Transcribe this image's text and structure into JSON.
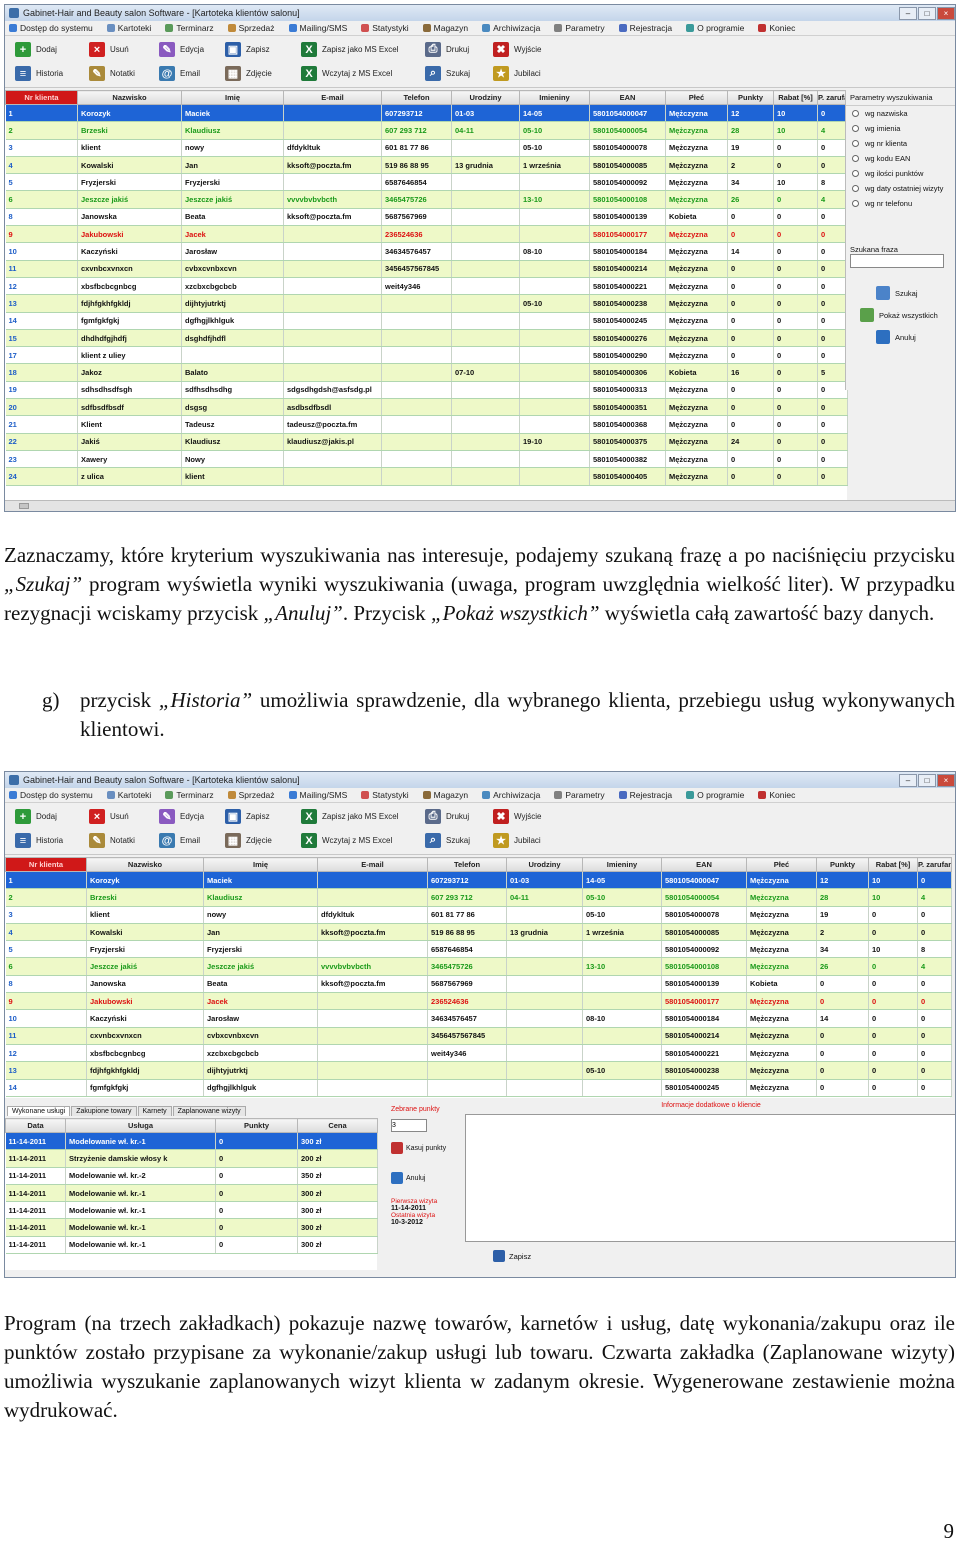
{
  "window": {
    "title": "Gabinet-Hair and Beauty salon Software - [Kartoteka klientów salonu]",
    "menu": [
      "Dostęp do systemu",
      "Kartoteki",
      "Terminarz",
      "Sprzedaż",
      "Mailing/SMS",
      "Statystyki",
      "Magazyn",
      "Archiwizacja",
      "Parametry",
      "Rejestracja",
      "O programie",
      "Koniec"
    ],
    "toolbar_row1": [
      "Dodaj",
      "Usuń",
      "Edycja",
      "Zapisz",
      "Zapisz jako MS Excel",
      "Drukuj",
      "Wyjście"
    ],
    "toolbar_row2": [
      "Historia",
      "Notatki",
      "Email",
      "Zdjęcie",
      "Wczytaj z MS Excel",
      "Szukaj",
      "Jubilaci"
    ],
    "columns": [
      "Nr klienta",
      "Nazwisko",
      "Imię",
      "E-mail",
      "Telefon",
      "Urodziny",
      "Imieniny",
      "EAN",
      "Płeć",
      "Punkty",
      "Rabat [%]",
      "P. zarufania"
    ]
  },
  "grid1": [
    [
      "1",
      "Korozyk",
      "Maciek",
      "",
      "607293712",
      "01-03",
      "14-05",
      "5801054000047",
      "Mężczyzna",
      "12",
      "10",
      "0"
    ],
    [
      "2",
      "Brzeski",
      "Klaudiusz",
      "",
      "607 293 712",
      "04-11",
      "05-10",
      "5801054000054",
      "Mężczyzna",
      "28",
      "10",
      "4"
    ],
    [
      "3",
      "klient",
      "nowy",
      "dfdykltuk",
      "601 81 77 86",
      "",
      "05-10",
      "5801054000078",
      "Mężczyzna",
      "19",
      "0",
      "0"
    ],
    [
      "4",
      "Kowalski",
      "Jan",
      "kksoft@poczta.fm",
      "519 86 88 95",
      "13 grudnia",
      "1 września",
      "5801054000085",
      "Mężczyzna",
      "2",
      "0",
      "0"
    ],
    [
      "5",
      "Fryzjerski",
      "Fryzjerski",
      "",
      "6587646854",
      "",
      "",
      "5801054000092",
      "Mężczyzna",
      "34",
      "10",
      "8"
    ],
    [
      "6",
      "Jeszcze jakiś",
      "Jeszcze jakiś",
      "vvvvbvbvbcth",
      "3465475726",
      "",
      "13-10",
      "5801054000108",
      "Mężczyzna",
      "26",
      "0",
      "4"
    ],
    [
      "8",
      "Janowska",
      "Beata",
      "kksoft@poczta.fm",
      "5687567969",
      "",
      "",
      "5801054000139",
      "Kobieta",
      "0",
      "0",
      "0"
    ],
    [
      "9",
      "Jakubowski",
      "Jacek",
      "",
      "236524636",
      "",
      "",
      "5801054000177",
      "Mężczyzna",
      "0",
      "0",
      "0"
    ],
    [
      "10",
      "Kaczyński",
      "Jarosław",
      "",
      "34634576457",
      "",
      "08-10",
      "5801054000184",
      "Mężczyzna",
      "14",
      "0",
      "0"
    ],
    [
      "11",
      "cxvnbcxvnxcn",
      "cvbxcvnbxcvn",
      "",
      "3456457567845",
      "",
      "",
      "5801054000214",
      "Mężczyzna",
      "0",
      "0",
      "0"
    ],
    [
      "12",
      "xbsfbcbcgnbcg",
      "xzcbxcbgcbcb",
      "",
      "weit4y346",
      "",
      "",
      "5801054000221",
      "Mężczyzna",
      "0",
      "0",
      "0"
    ],
    [
      "13",
      "fdjhfgkhfgkldj",
      "dijhtyjutrktj",
      "",
      "",
      "",
      "05-10",
      "5801054000238",
      "Mężczyzna",
      "0",
      "0",
      "0"
    ],
    [
      "14",
      "fgmfgkfgkj",
      "dgfhgjlkhlguk",
      "",
      "",
      "",
      "",
      "5801054000245",
      "Mężczyzna",
      "0",
      "0",
      "0"
    ],
    [
      "15",
      "dhdhdfgjhdfj",
      "dsghdfjhdfl",
      "",
      "",
      "",
      "",
      "5801054000276",
      "Mężczyzna",
      "0",
      "0",
      "0"
    ],
    [
      "17",
      "klient z uliey",
      "",
      "",
      "",
      "",
      "",
      "5801054000290",
      "Mężczyzna",
      "0",
      "0",
      "0"
    ],
    [
      "18",
      "Jakoz",
      "Balato",
      "",
      "",
      "07-10",
      "",
      "5801054000306",
      "Kobieta",
      "16",
      "0",
      "5"
    ],
    [
      "19",
      "sdhsdhsdfsgh",
      "sdfhsdhsdhg",
      "sdgsdhgdsh@asfsdg.pl",
      "",
      "",
      "",
      "5801054000313",
      "Mężczyzna",
      "0",
      "0",
      "0"
    ],
    [
      "20",
      "sdfbsdfbsdf",
      "dsgsg",
      "asdbsdfbsdl",
      "",
      "",
      "",
      "5801054000351",
      "Mężczyzna",
      "0",
      "0",
      "0"
    ],
    [
      "21",
      "Klient",
      "Tadeusz",
      "tadeusz@poczta.fm",
      "",
      "",
      "",
      "5801054000368",
      "Mężczyzna",
      "0",
      "0",
      "0"
    ],
    [
      "22",
      "Jakiś",
      "Klaudiusz",
      "klaudiusz@jakis.pl",
      "",
      "",
      "19-10",
      "5801054000375",
      "Mężczyzna",
      "24",
      "0",
      "0"
    ],
    [
      "23",
      "Xawery",
      "Nowy",
      "",
      "",
      "",
      "",
      "5801054000382",
      "Mężczyzna",
      "0",
      "0",
      "0"
    ],
    [
      "24",
      "z ulica",
      "klient",
      "",
      "",
      "",
      "",
      "5801054000405",
      "Mężczyzna",
      "0",
      "0",
      "0"
    ]
  ],
  "grid2": [
    [
      "1",
      "Korozyk",
      "Maciek",
      "",
      "607293712",
      "01-03",
      "14-05",
      "5801054000047",
      "Mężczyzna",
      "12",
      "10",
      "0"
    ],
    [
      "2",
      "Brzeski",
      "Klaudiusz",
      "",
      "607 293 712",
      "04-11",
      "05-10",
      "5801054000054",
      "Mężczyzna",
      "28",
      "10",
      "4"
    ],
    [
      "3",
      "klient",
      "nowy",
      "dfdykltuk",
      "601 81 77 86",
      "",
      "05-10",
      "5801054000078",
      "Mężczyzna",
      "19",
      "0",
      "0"
    ],
    [
      "4",
      "Kowalski",
      "Jan",
      "kksoft@poczta.fm",
      "519 86 88 95",
      "13 grudnia",
      "1 września",
      "5801054000085",
      "Mężczyzna",
      "2",
      "0",
      "0"
    ],
    [
      "5",
      "Fryzjerski",
      "Fryzjerski",
      "",
      "6587646854",
      "",
      "",
      "5801054000092",
      "Mężczyzna",
      "34",
      "10",
      "8"
    ],
    [
      "6",
      "Jeszcze jakiś",
      "Jeszcze jakiś",
      "vvvvbvbvbcth",
      "3465475726",
      "",
      "13-10",
      "5801054000108",
      "Mężczyzna",
      "26",
      "0",
      "4"
    ],
    [
      "8",
      "Janowska",
      "Beata",
      "kksoft@poczta.fm",
      "5687567969",
      "",
      "",
      "5801054000139",
      "Kobieta",
      "0",
      "0",
      "0"
    ],
    [
      "9",
      "Jakubowski",
      "Jacek",
      "",
      "236524636",
      "",
      "",
      "5801054000177",
      "Mężczyzna",
      "0",
      "0",
      "0"
    ],
    [
      "10",
      "Kaczyński",
      "Jarosław",
      "",
      "34634576457",
      "",
      "08-10",
      "5801054000184",
      "Mężczyzna",
      "14",
      "0",
      "0"
    ],
    [
      "11",
      "cxvnbcxvnxcn",
      "cvbxcvnbxcvn",
      "",
      "3456457567845",
      "",
      "",
      "5801054000214",
      "Mężczyzna",
      "0",
      "0",
      "0"
    ],
    [
      "12",
      "xbsfbcbcgnbcg",
      "xzcbxcbgcbcb",
      "",
      "weit4y346",
      "",
      "",
      "5801054000221",
      "Mężczyzna",
      "0",
      "0",
      "0"
    ],
    [
      "13",
      "fdjhfgkhfgkldj",
      "dijhtyjutrktj",
      "",
      "",
      "",
      "05-10",
      "5801054000238",
      "Mężczyzna",
      "0",
      "0",
      "0"
    ],
    [
      "14",
      "fgmfgkfgkj",
      "dgfhgjlkhlguk",
      "",
      "",
      "",
      "",
      "5801054000245",
      "Mężczyzna",
      "0",
      "0",
      "0"
    ]
  ],
  "search_panel": {
    "title": "Parametry wyszukiwania",
    "options": [
      "wg nazwiska",
      "wg imienia",
      "wg nr klienta",
      "wg kodu EAN",
      "wg ilości punktów",
      "wg daty ostatniej wizyty",
      "wg nr telefonu"
    ],
    "phrase_label": "Szukana fraza",
    "buttons": [
      "Szukaj",
      "Pokaż wszystkich",
      "Anuluj"
    ]
  },
  "history_panel": {
    "tabs": [
      "Wykonane usługi",
      "Zakupione towary",
      "Karnety",
      "Zaplanowane wizyty"
    ],
    "columns": [
      "Data",
      "Usługa",
      "Punkty",
      "Cena"
    ],
    "rows": [
      [
        "11-14-2011",
        "Modelowanie wł. kr.-1",
        "0",
        "300 zł"
      ],
      [
        "11-14-2011",
        "Strzyżenie damskie włosy k",
        "0",
        "200 zł"
      ],
      [
        "11-14-2011",
        "Modelowanie wł. kr.-2",
        "0",
        "350 zł"
      ],
      [
        "11-14-2011",
        "Modelowanie wł. kr.-1",
        "0",
        "300 zł"
      ],
      [
        "11-14-2011",
        "Modelowanie wł. kr.-1",
        "0",
        "300 zł"
      ],
      [
        "11-14-2011",
        "Modelowanie wł. kr.-1",
        "0",
        "300 zł"
      ],
      [
        "11-14-2011",
        "Modelowanie wł. kr.-1",
        "0",
        "300 zł"
      ]
    ],
    "points_label": "Zebrane punkty",
    "points_value": "3",
    "reset_label": "Kasuj punkty",
    "cancel_label": "Anuluj",
    "first_visit_label": "Pierwsza wizyta",
    "first_visit": "11-14-2011",
    "last_visit_label": "Ostatnia wizyta",
    "last_visit": "10-3-2012",
    "info_title": "Informacje dodatkowe o kliencie",
    "save_label": "Zapisz"
  },
  "text": {
    "p1_a": "Zaznaczamy, które kryterium wyszukiwania nas interesuje, podajemy szukaną frazę a po naciśnięciu przycisku ",
    "p1_szukaj": "„Szukaj”",
    "p1_b": " program wyświetla wyniki wyszukiwania (uwaga, program uwzględnia wielkość liter). W przypadku rezygnacji wciskamy przycisk ",
    "p1_anuluj": "„Anuluj”",
    "p1_c": ". Przycisk ",
    "p1_pokaz": "„Pokaż wszystkich”",
    "p1_d": " wyświetla całą zawartość bazy danych.",
    "p2_label": "g)",
    "p2_a": "przycisk ",
    "p2_historia": "„Historia”",
    "p2_b": " umożliwia sprawdzenie, dla wybranego klienta, przebiegu usług wykonywanych klientowi.",
    "p3": "Program (na trzech zakładkach) pokazuje nazwę towarów, karnetów i usług, datę wykonania/zakupu oraz ile punktów zostało przypisane za wykonanie/zakup usługi lub towaru. Czwarta zakładka (Zaplanowane wizyty) umożliwia wyszukanie zaplanowanych wizyt klienta w zadanym okresie. Wygenerowane zestawienie można wydrukować.",
    "page_number": "9"
  },
  "colors": {
    "selected_row": "#1e64d6",
    "row_alt": "#eef9c8",
    "header_highlight": "#d01818",
    "green_text": "#1a9a1a",
    "red_text": "#d11111"
  }
}
